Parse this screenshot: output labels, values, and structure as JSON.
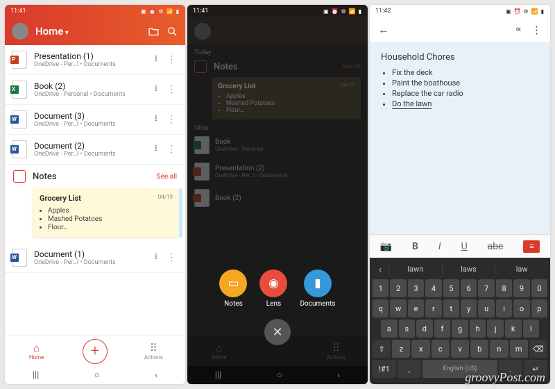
{
  "status": {
    "time1": "11:41",
    "time2": "11:41",
    "time3": "11:42",
    "icons_l": "◎ ✎ ⟳ ✉ ⚑ ▣ ✕",
    "icons_r": "▣ ⏰ ⚙ 📶 ▮"
  },
  "p1": {
    "title": "Home",
    "files": [
      {
        "icon": "pp",
        "lt": "P",
        "name": "Presentation (1)",
        "loc": "OneDrive - Per…l • Documents"
      },
      {
        "icon": "xl",
        "lt": "X",
        "name": "Book (2)",
        "loc": "OneDrive - Personal • Documents"
      },
      {
        "icon": "wd",
        "lt": "W",
        "name": "Document (3)",
        "loc": "OneDrive - Per…l • Documents"
      },
      {
        "icon": "wd",
        "lt": "W",
        "name": "Document (2)",
        "loc": "OneDrive - Per…l • Documents"
      }
    ],
    "notes_label": "Notes",
    "seeall": "See all",
    "note": {
      "title": "Grocery List",
      "date": "04/19",
      "items": [
        "Apples",
        "Mashed Potatoes",
        "Flour…"
      ]
    },
    "file5": {
      "icon": "wd",
      "lt": "W",
      "name": "Document (1)",
      "loc": "OneDrive - Per…l • Documents"
    },
    "tabs": {
      "home": "Home",
      "actions": "Actions"
    }
  },
  "p2": {
    "today": "Today",
    "notes": "Notes",
    "seeall": "See all",
    "note": {
      "title": "Grocery List",
      "date": "04/19",
      "items": [
        "Apples",
        "Mashed Potatoes",
        "Flour…"
      ]
    },
    "older": "Older",
    "rows": [
      {
        "name": "Book",
        "loc": "OneDrive - Personal"
      },
      {
        "name": "Presentation (2)",
        "loc": "OneDrive - Per…l • Documents"
      },
      {
        "name": "Book (2)",
        "loc": ""
      }
    ],
    "fab": {
      "notes": "Notes",
      "lens": "Lens",
      "docs": "Documents"
    },
    "tabs": {
      "home": "Home",
      "actions": "Actions"
    }
  },
  "p3": {
    "title": "Household Chores",
    "items": [
      "Fix the deck",
      "Paint the boathouse",
      "Replace the car radio",
      "Do the lawn"
    ],
    "editbar": {
      "cam": "📷",
      "b": "B",
      "i": "I",
      "u": "U",
      "s": "abc",
      "list": "≡"
    },
    "sugg": [
      "lawn",
      "laws",
      "law"
    ],
    "rows": [
      [
        "1",
        "2",
        "3",
        "4",
        "5",
        "6",
        "7",
        "8",
        "9",
        "0"
      ],
      [
        "q",
        "w",
        "e",
        "r",
        "t",
        "y",
        "u",
        "i",
        "o",
        "p"
      ],
      [
        "a",
        "s",
        "d",
        "f",
        "g",
        "h",
        "j",
        "k",
        "l"
      ],
      [
        "⇧",
        "z",
        "x",
        "c",
        "v",
        "b",
        "n",
        "m",
        "⌫"
      ],
      [
        "!#1",
        ",",
        "English (US)",
        ".",
        "↵"
      ]
    ]
  },
  "watermark": "groovyPost.com"
}
